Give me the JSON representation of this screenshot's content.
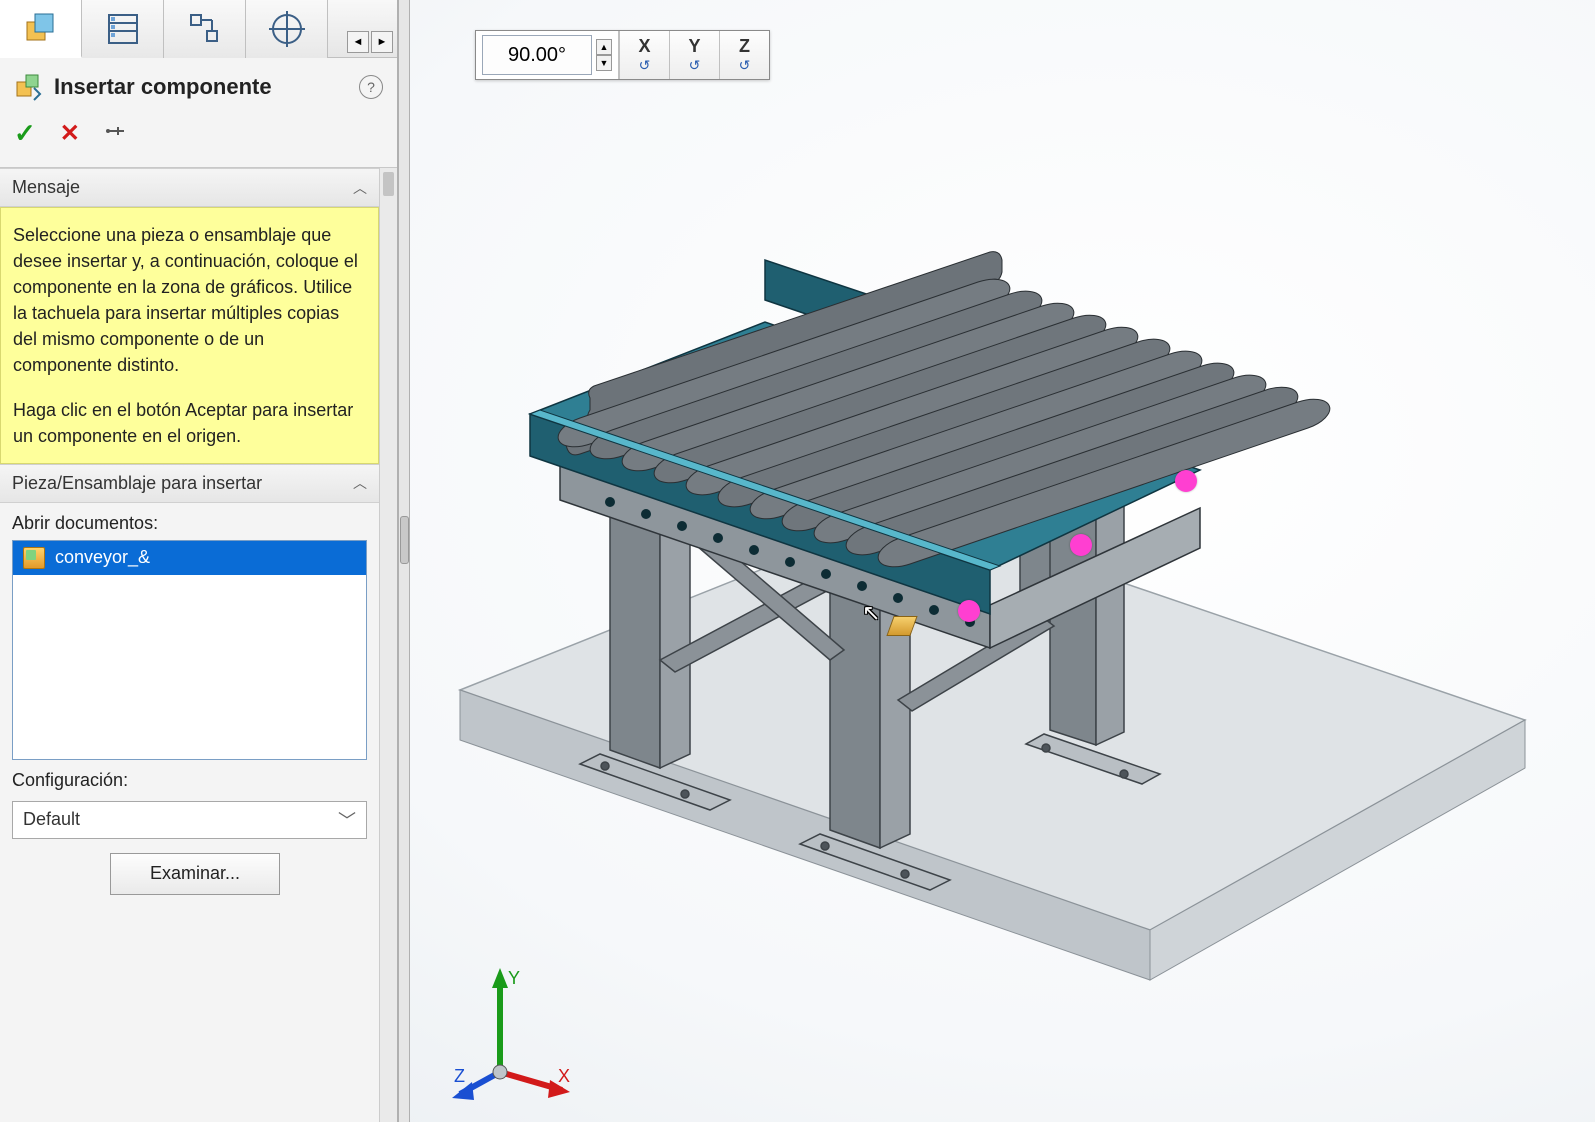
{
  "panel": {
    "title": "Insertar componente",
    "help": "?",
    "actions": {
      "ok": "✓",
      "cancel": "✕",
      "pin": "📌"
    },
    "tabs": {
      "left_arrow": "◄",
      "right_arrow": "►"
    }
  },
  "message": {
    "heading": "Mensaje",
    "body1": "Seleccione una pieza o ensamblaje que desee insertar y, a continuación, coloque el componente en la zona de gráficos. Utilice la tachuela para insertar múltiples copias del mismo componente o de un componente distinto.",
    "body2": "Haga clic en el botón Aceptar para insertar un componente en el origen."
  },
  "insert": {
    "heading": "Pieza/Ensamblaje para insertar",
    "open_docs_label": "Abrir documentos:",
    "docs": [
      "conveyor_&"
    ],
    "config_label": "Configuración:",
    "config_value": "Default",
    "browse": "Examinar..."
  },
  "rotate": {
    "angle": "90.00°",
    "axes": [
      "X",
      "Y",
      "Z"
    ]
  },
  "triad": {
    "x": "X",
    "y": "Y",
    "z": "Z"
  }
}
